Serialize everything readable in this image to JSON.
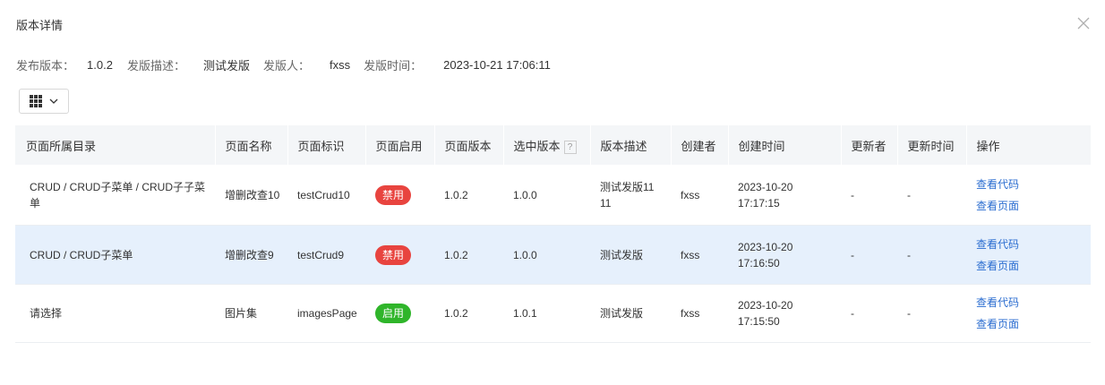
{
  "dialog": {
    "title": "版本详情"
  },
  "info": {
    "version_label": "发布版本：",
    "version_value": "1.0.2",
    "desc_label": "发版描述：",
    "desc_value": "测试发版",
    "publisher_label": "发版人：",
    "publisher_value": "fxss",
    "time_label": "发版时间：",
    "time_value": "2023-10-21 17:06:11"
  },
  "toolbar": {
    "columns_icon": "grid-icon",
    "dropdown_icon": "chevron-down-icon"
  },
  "table": {
    "headers": [
      "页面所属目录",
      "页面名称",
      "页面标识",
      "页面启用",
      "页面版本",
      "选中版本",
      "版本描述",
      "创建者",
      "创建时间",
      "更新者",
      "更新时间",
      "操作"
    ],
    "help_mark": "?",
    "rows": [
      {
        "directory": "CRUD / CRUD子菜单 / CRUD子子菜单",
        "name": "增删改查10",
        "key": "testCrud10",
        "enabled": "禁用",
        "page_version": "1.0.2",
        "selected_version": "1.0.0",
        "version_desc": "测试发版1111",
        "creator": "fxss",
        "created_date": "2023-10-20",
        "created_time": "17:17:15",
        "updater": "-",
        "updated_at": "-",
        "action_code": "查看代码",
        "action_page": "查看页面"
      },
      {
        "directory": "CRUD / CRUD子菜单",
        "name": "增删改查9",
        "key": "testCrud9",
        "enabled": "禁用",
        "page_version": "1.0.2",
        "selected_version": "1.0.0",
        "version_desc": "测试发版",
        "creator": "fxss",
        "created_date": "2023-10-20",
        "created_time": "17:16:50",
        "updater": "-",
        "updated_at": "-",
        "action_code": "查看代码",
        "action_page": "查看页面"
      },
      {
        "directory": "请选择",
        "name": "图片集",
        "key": "imagesPage",
        "enabled": "启用",
        "page_version": "1.0.2",
        "selected_version": "1.0.1",
        "version_desc": "测试发版",
        "creator": "fxss",
        "created_date": "2023-10-20",
        "created_time": "17:15:50",
        "updater": "-",
        "updated_at": "-",
        "action_code": "查看代码",
        "action_page": "查看页面"
      }
    ]
  },
  "colors": {
    "disabled_badge": "#e8443f",
    "enabled_badge": "#2fb52a",
    "link": "#2b6dd0",
    "selected_row": "#e6f0fc",
    "header_bg": "#f4f6f8"
  }
}
